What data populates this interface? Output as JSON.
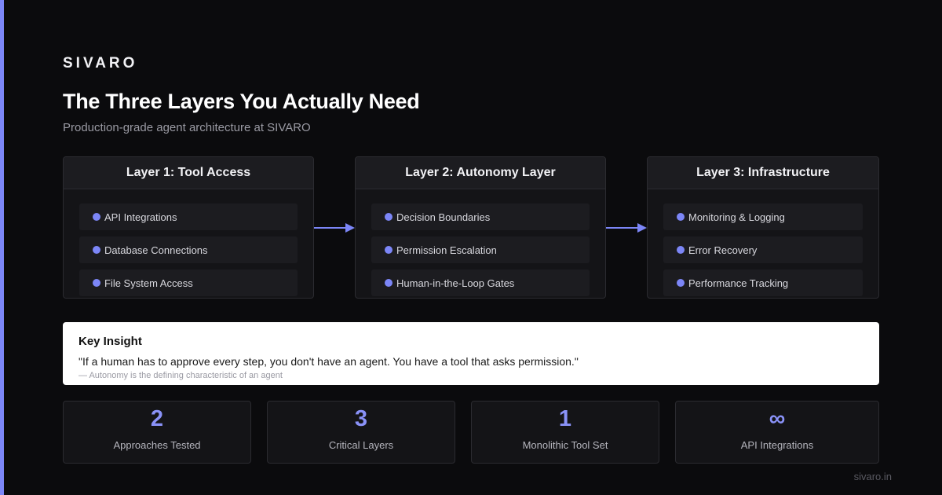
{
  "brand": "SIVARO",
  "title": "The Three Layers You Actually Need",
  "subtitle": "Production-grade agent architecture at SIVARO",
  "layers": [
    {
      "title": "Layer 1: Tool Access",
      "items": [
        "API Integrations",
        "Database Connections",
        "File System Access"
      ]
    },
    {
      "title": "Layer 2: Autonomy Layer",
      "items": [
        "Decision Boundaries",
        "Permission Escalation",
        "Human-in-the-Loop Gates"
      ]
    },
    {
      "title": "Layer 3: Infrastructure",
      "items": [
        "Monitoring & Logging",
        "Error Recovery",
        "Performance Tracking"
      ]
    }
  ],
  "insight": {
    "title": "Key Insight",
    "quote": "\"If a human has to approve every step, you don't have an agent. You have a tool that asks permission.\"",
    "attribution": "— Autonomy is the defining characteristic of an agent"
  },
  "stats": [
    {
      "value": "2",
      "label": "Approaches Tested"
    },
    {
      "value": "3",
      "label": "Critical Layers"
    },
    {
      "value": "1",
      "label": "Monolithic Tool Set"
    },
    {
      "value": "∞",
      "label": "API Integrations"
    }
  ],
  "footer": "sivaro.in",
  "colors": {
    "accent": "#7c86f7",
    "background": "#0b0b0d",
    "card": "#141417",
    "stat_value": "#8a92f8"
  }
}
